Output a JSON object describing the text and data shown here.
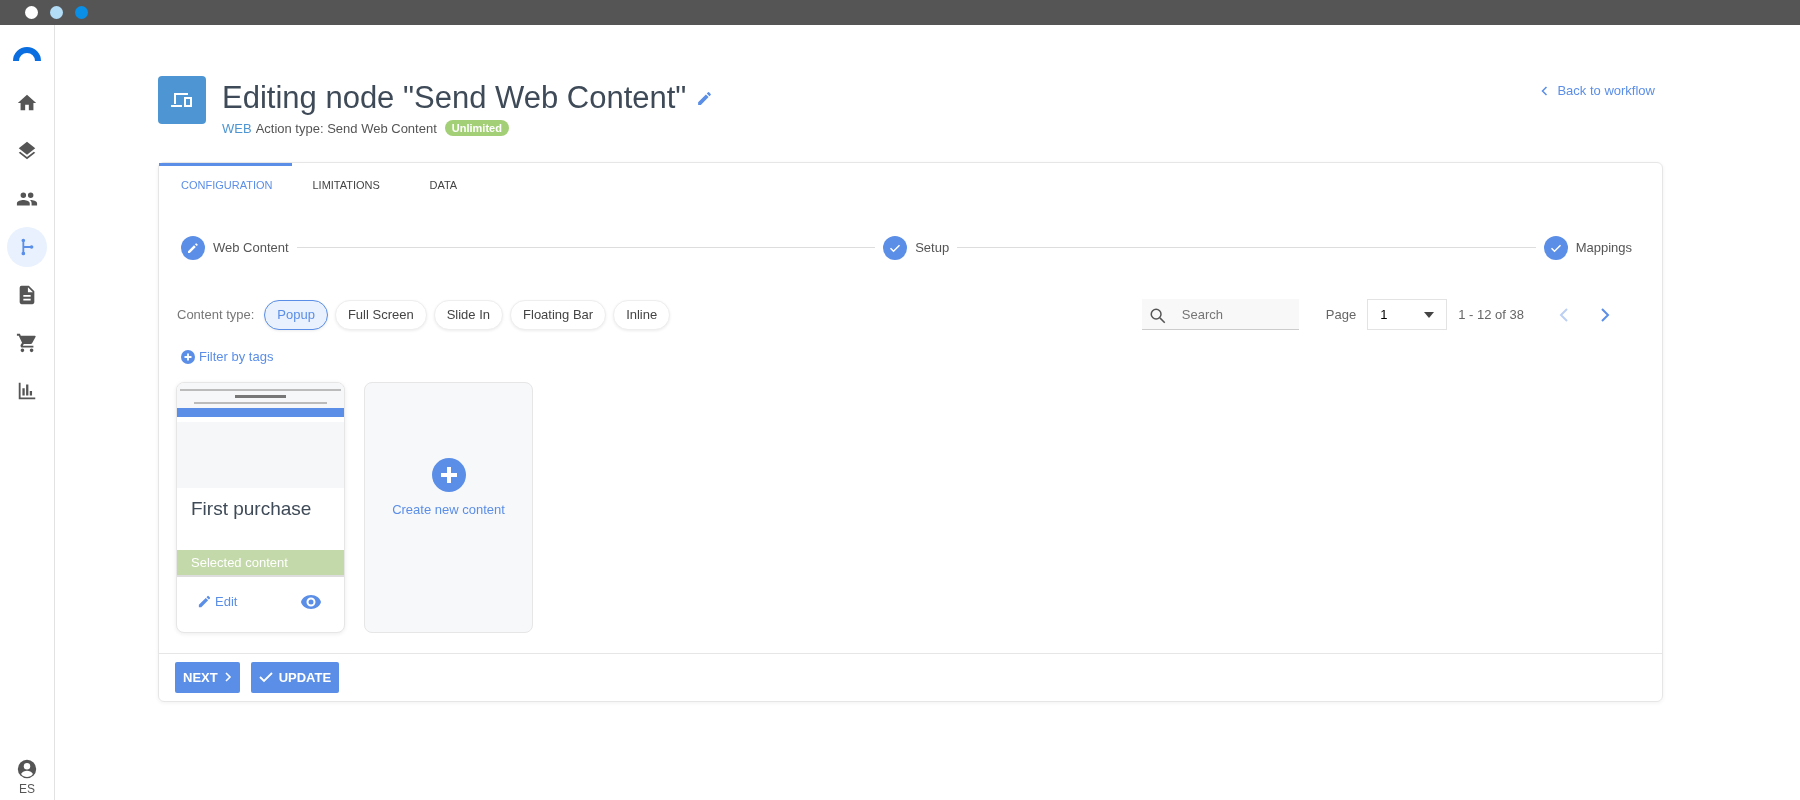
{
  "sidebar": {
    "items": [
      {
        "selected": false
      },
      {
        "selected": false
      },
      {
        "selected": false
      },
      {
        "selected": true
      },
      {
        "selected": false
      },
      {
        "selected": false
      },
      {
        "selected": false
      }
    ],
    "user": "ES"
  },
  "header": {
    "title": "Editing node \"Send Web Content\"",
    "channel": "WEB",
    "action_type": "Action type: Send Web Content",
    "badge": "Unlimited",
    "back_link": "Back to workflow"
  },
  "tabs": [
    {
      "label": "CONFIGURATION",
      "selected": true
    },
    {
      "label": "LIMITATIONS",
      "selected": false
    },
    {
      "label": "DATA",
      "selected": false
    }
  ],
  "steps": [
    {
      "label": "Web Content",
      "kind": "current"
    },
    {
      "label": "Setup",
      "kind": "done"
    },
    {
      "label": "Mappings",
      "kind": "done"
    }
  ],
  "content_type": {
    "label": "Content type:",
    "options": [
      {
        "label": "Popup",
        "selected": true
      },
      {
        "label": "Full Screen",
        "selected": false
      },
      {
        "label": "Slide In",
        "selected": false
      },
      {
        "label": "Floating Bar",
        "selected": false
      },
      {
        "label": "Inline",
        "selected": false
      }
    ]
  },
  "search": {
    "placeholder": "Search"
  },
  "pagination": {
    "label": "Page",
    "value": "1",
    "range": "1 - 12 of 38",
    "prev_disabled": true,
    "next_disabled": false
  },
  "filter_link": "Filter by tags",
  "cards": [
    {
      "kind": "content",
      "title": "First purchase",
      "status": "Selected content",
      "edit": "Edit"
    },
    {
      "kind": "create",
      "label": "Create new content"
    }
  ],
  "footer": {
    "next": "NEXT",
    "update": "UPDATE"
  }
}
